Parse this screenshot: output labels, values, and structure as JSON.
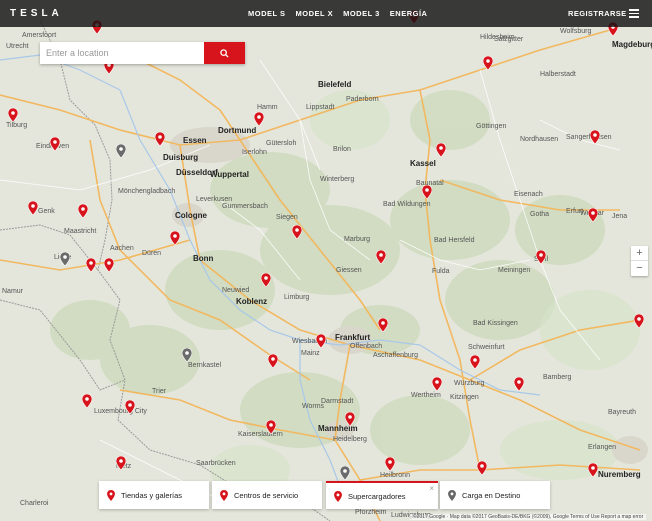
{
  "header": {
    "logo": "TESLA",
    "nav": [
      "MODEL S",
      "MODEL X",
      "MODEL 3",
      "ENERGÍA"
    ],
    "register": "REGISTRARSE",
    "colors": {
      "bar": "#141414",
      "accent": "#d7141c"
    }
  },
  "search": {
    "placeholder": "Enter a location"
  },
  "zoom": {
    "in": "+",
    "out": "−"
  },
  "legend": [
    {
      "label": "Tiendas y galerías",
      "icon": "red-pin-icon"
    },
    {
      "label": "Centros de servicio",
      "icon": "red-pin-icon"
    },
    {
      "label": "Supercargadores",
      "icon": "red-pin-icon",
      "active": true
    },
    {
      "label": "Carga en Destino",
      "icon": "gray-pin-icon"
    }
  ],
  "legend_close": "×",
  "attribution": "©2017 Google · Map data ©2017 GeoBasis-DE/BKG (©2009), Google    Terms of Use    Report a map error",
  "cities": [
    "Amersfoort",
    "Utrecht",
    "Tilburg",
    "Eindhoven",
    "Genk",
    "Maastricht",
    "Liège",
    "Namur",
    "Essen",
    "Duisburg",
    "Dortmund",
    "Düsseldorf",
    "Wuppertal",
    "Mönchengladbach",
    "Cologne",
    "Aachen",
    "Düren",
    "Bonn",
    "Koblenz",
    "Neuwied",
    "Bielefeld",
    "Paderborn",
    "Hamm",
    "Lippstadt",
    "Iserlohn",
    "Siegen",
    "Marburg",
    "Giessen",
    "Kassel",
    "Göttingen",
    "Hildesheim",
    "Salzgitter",
    "Magdeburg",
    "Wolfsburg",
    "Halberstadt",
    "Nordhausen",
    "Eisenach",
    "Erfurt",
    "Weimar",
    "Jena",
    "Gotha",
    "Fulda",
    "Frankfurt",
    "Wiesbaden",
    "Mainz",
    "Darmstadt",
    "Offenbach",
    "Aschaffenburg",
    "Würzburg",
    "Schweinfurt",
    "Bamberg",
    "Erlangen",
    "Nuremberg",
    "Mannheim",
    "Heidelberg",
    "Kaiserslautern",
    "Luxembourg City",
    "Trier",
    "Metz",
    "Saarbrücken",
    "Heilbronn",
    "Pforzheim",
    "Ludwigsburg",
    "Bayreuth",
    "Bad Kissingen",
    "Meiningen",
    "Suhl",
    "Limburg",
    "Worms",
    "Wertheim",
    "Kitzingen",
    "Bad Hersfeld",
    "Bad Wildungen",
    "Baunatal",
    "Sangerhausen",
    "Leverkusen",
    "Gummersbach",
    "Winterberg",
    "Brilon",
    "Bernkastel",
    "Charleroi",
    "Gütersloh"
  ]
}
